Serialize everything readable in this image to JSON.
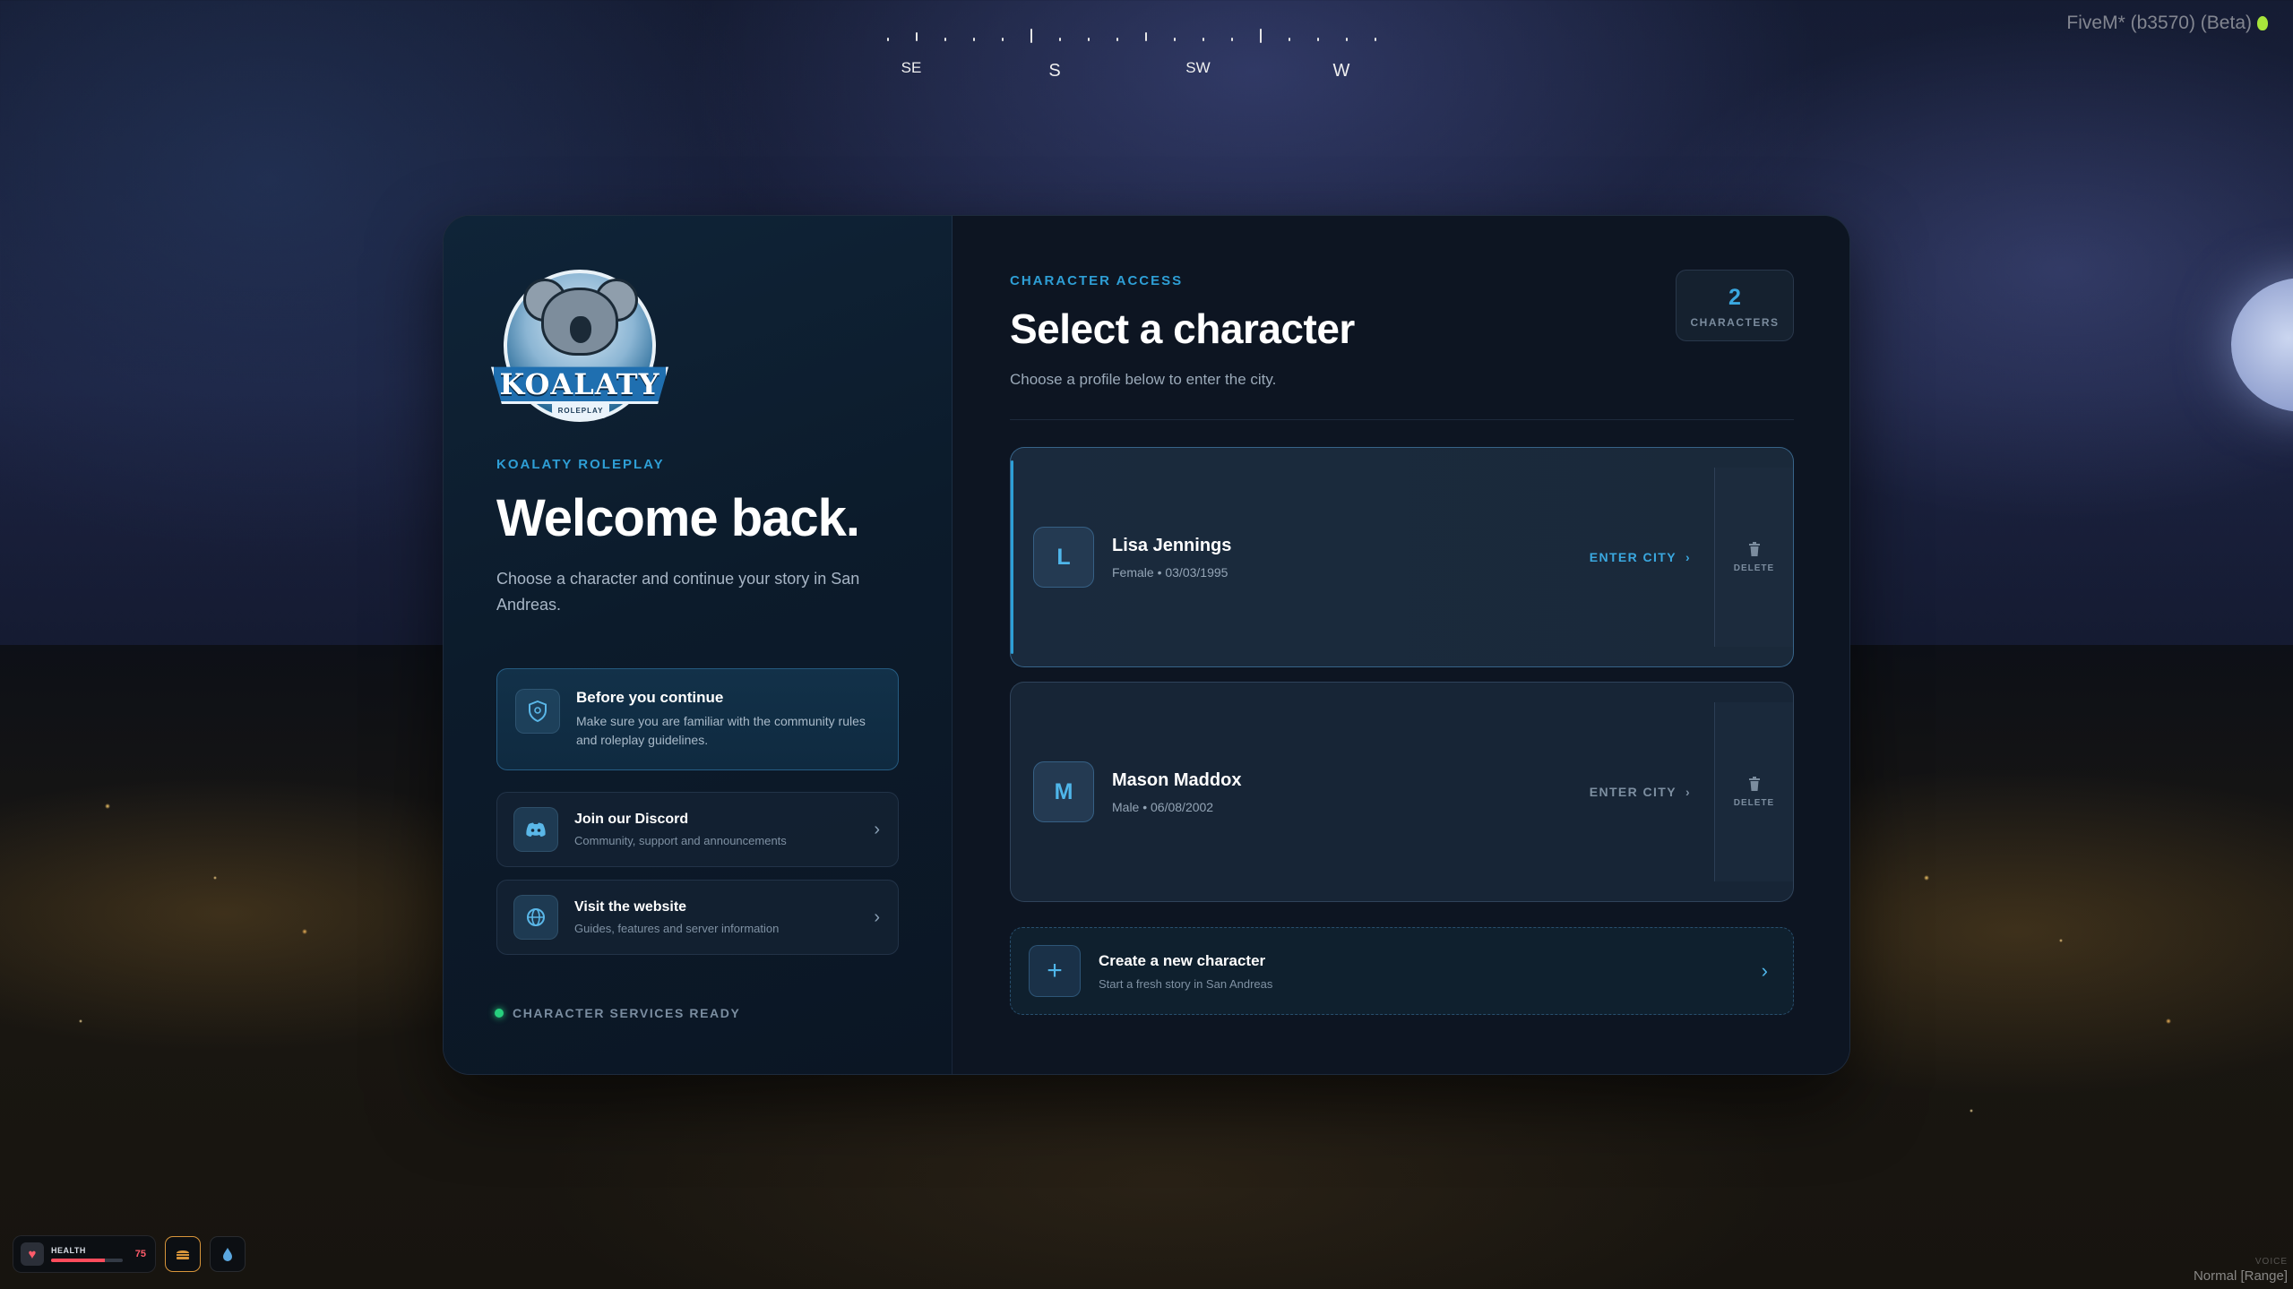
{
  "compass": {
    "labels": [
      {
        "text": "SE"
      },
      {
        "text": "S"
      },
      {
        "text": "SW"
      },
      {
        "text": "W"
      }
    ]
  },
  "fivem": {
    "title": "FiveM* (b3570) (Beta)"
  },
  "left": {
    "logo_text": "KOALATY",
    "logo_sub": "ROLEPLAY",
    "eyebrow": "KOALATY ROLEPLAY",
    "title": "Welcome back.",
    "description": "Choose a character and continue your story in San Andreas.",
    "notice": {
      "title": "Before you continue",
      "text": "Make sure you are familiar with the community rules and roleplay guidelines.",
      "icon": "shield-icon"
    },
    "links": [
      {
        "title": "Join our Discord",
        "subtitle": "Community, support and announcements",
        "icon": "discord-icon"
      },
      {
        "title": "Visit the website",
        "subtitle": "Guides, features and server information",
        "icon": "globe-icon"
      }
    ],
    "status": "CHARACTER SERVICES READY"
  },
  "right": {
    "eyebrow": "CHARACTER ACCESS",
    "title": "Select a character",
    "description": "Choose a profile below to enter the city.",
    "count": {
      "value": "2",
      "label": "CHARACTERS"
    },
    "characters": [
      {
        "initial": "L",
        "name": "Lisa Jennings",
        "meta": "Female • 03/03/1995",
        "enter": "ENTER CITY",
        "delete": "DELETE",
        "selected": true
      },
      {
        "initial": "M",
        "name": "Mason Maddox",
        "meta": "Male • 06/08/2002",
        "enter": "ENTER CITY",
        "delete": "DELETE",
        "selected": false
      }
    ],
    "create": {
      "title": "Create a new character",
      "subtitle": "Start a fresh story in San Andreas"
    }
  },
  "hud": {
    "health_label": "HEALTH",
    "health_value": "75",
    "health_fraction": 0.75
  },
  "voice": {
    "label": "VOICE",
    "mode": "Normal [Range]"
  },
  "colors": {
    "accent": "#2e9fd6",
    "ready": "#27d07e",
    "health": "#ff4c5c"
  }
}
